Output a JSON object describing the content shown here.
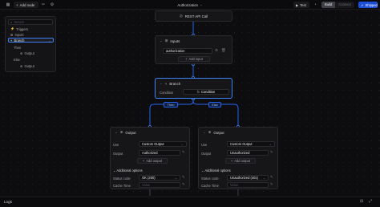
{
  "toolbar": {
    "add_node_label": "Add node",
    "workflow_title": "Authorization",
    "test_label": "Test",
    "modes": [
      "Build",
      "Connect"
    ],
    "publish_label": "Shipped"
  },
  "outline": {
    "search_placeholder": "Search",
    "items": [
      "Triggers",
      "Inputs",
      "Branch",
      "Then",
      "Output",
      "Else",
      "Output"
    ]
  },
  "canvas": {
    "rest_node_label": "REST API Call",
    "inputs_node": {
      "title": "Inputs",
      "input_value": "authorization",
      "add_input_label": "Add input"
    },
    "branch_node": {
      "title": "Branch",
      "condition_label": "Condition",
      "condition_value": "Condition"
    },
    "branch_tags": [
      "Then",
      "Else"
    ],
    "output_nodes": [
      {
        "title": "Output",
        "use_label": "Use",
        "use_value": "Custom Output",
        "output_label": "Output",
        "output_value": "Authorized",
        "add_output_label": "Add output",
        "additional_label": "Additional options",
        "status_label": "Status code",
        "status_value": "OK (200)",
        "cache_label": "Cache Time",
        "cache_placeholder": "Value"
      },
      {
        "title": "Output",
        "use_label": "Use",
        "use_value": "Custom Output",
        "output_label": "Output",
        "output_value": "Unauthorized",
        "add_output_label": "Add output",
        "additional_label": "Additional options",
        "status_label": "Status code",
        "status_value": "Unauthorized (401)",
        "cache_label": "Cache Time",
        "cache_placeholder": "Value"
      }
    ]
  },
  "logs": {
    "label": "Logs"
  },
  "colors": {
    "accent": "#3b82f6",
    "edge": "#2563eb",
    "node_bg": "#161618",
    "canvas_bg": "#0d0d0f"
  }
}
